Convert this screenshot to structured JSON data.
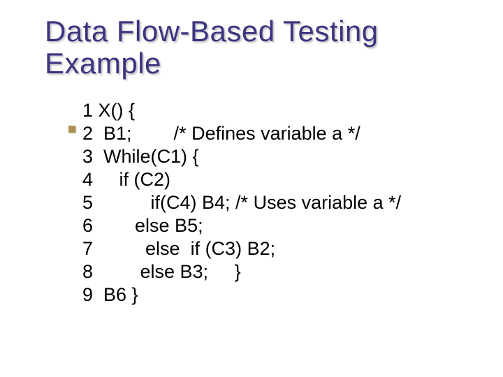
{
  "title": {
    "line1": "Data Flow-Based Testing",
    "line2": "Example"
  },
  "code": {
    "l1": "1 X() {",
    "l2": "2  B1;        /* Defines variable a */",
    "l3": "3  While(C1) {",
    "l4": "4     if (C2)",
    "l5": "5           if(C4) B4; /* Uses variable a */",
    "l6": "6        else B5;",
    "l7": "7          else  if (C3) B2;",
    "l8": "8         else B3;     }",
    "l9": "9  B6 }"
  }
}
